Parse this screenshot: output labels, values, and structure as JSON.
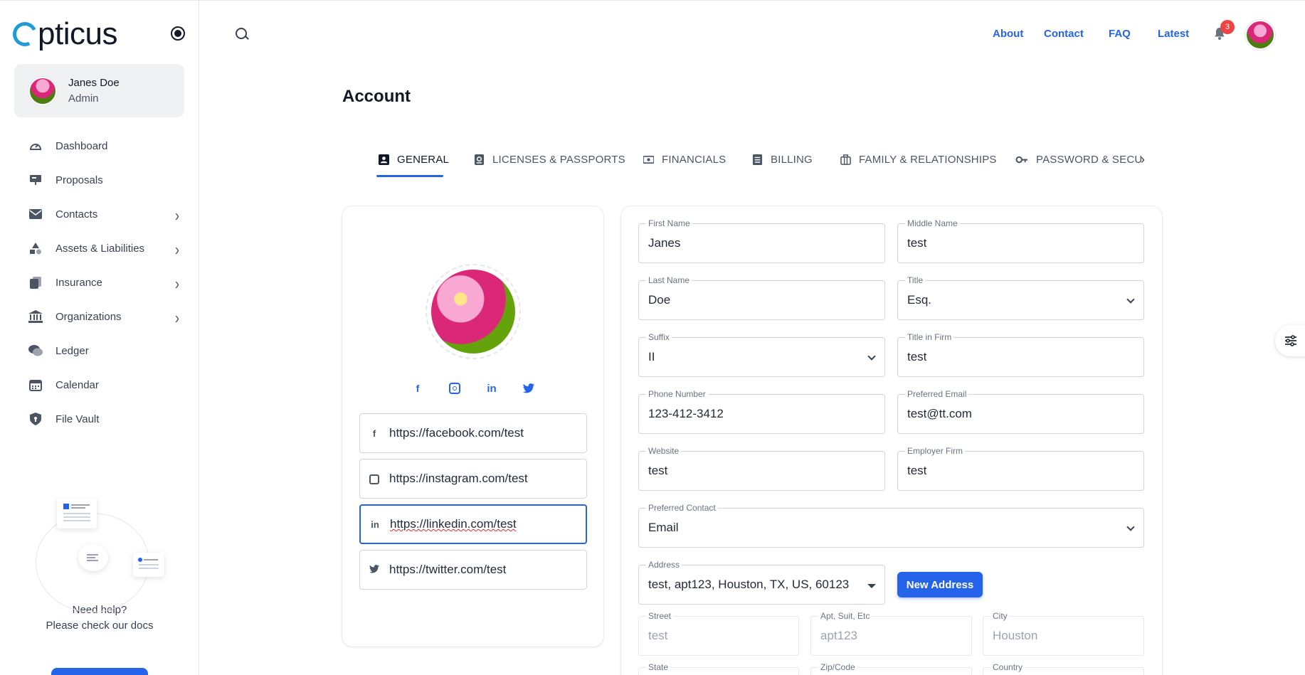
{
  "logo": {
    "text": "pticus"
  },
  "user": {
    "name": "Janes Doe",
    "role": "Admin"
  },
  "nav": [
    {
      "label": "Dashboard",
      "icon": "dashboard-icon",
      "has_children": false
    },
    {
      "label": "Proposals",
      "icon": "presentation-icon",
      "has_children": false
    },
    {
      "label": "Contacts",
      "icon": "mail-icon",
      "has_children": true
    },
    {
      "label": "Assets & Liabilities",
      "icon": "shapes-icon",
      "has_children": true
    },
    {
      "label": "Insurance",
      "icon": "documents-icon",
      "has_children": true
    },
    {
      "label": "Organizations",
      "icon": "bank-icon",
      "has_children": true
    },
    {
      "label": "Ledger",
      "icon": "chat-icon",
      "has_children": false
    },
    {
      "label": "Calendar",
      "icon": "calendar-icon",
      "has_children": false
    },
    {
      "label": "File Vault",
      "icon": "shield-lock-icon",
      "has_children": false
    }
  ],
  "help": {
    "line1": "Need help?",
    "line2": "Please check our docs"
  },
  "header": {
    "links": [
      "About",
      "Contact",
      "FAQ",
      "Latest"
    ],
    "notification_count": "3"
  },
  "page": {
    "title": "Account"
  },
  "tabs": [
    {
      "label": "GENERAL",
      "active": true
    },
    {
      "label": "LICENSES & PASSPORTS",
      "active": false
    },
    {
      "label": "FINANCIALS",
      "active": false
    },
    {
      "label": "BILLING",
      "active": false
    },
    {
      "label": "FAMILY & RELATIONSHIPS",
      "active": false
    },
    {
      "label": "PASSWORD & SECU",
      "active": false
    }
  ],
  "social": {
    "facebook": "https://facebook.com/test",
    "instagram": "https://instagram.com/test",
    "linkedin": "https://linkedin.com/test",
    "twitter": "https://twitter.com/test"
  },
  "form": {
    "first_name": {
      "label": "First Name",
      "value": "Janes"
    },
    "middle_name": {
      "label": "Middle Name",
      "value": "test"
    },
    "last_name": {
      "label": "Last Name",
      "value": "Doe"
    },
    "title": {
      "label": "Title",
      "value": "Esq."
    },
    "suffix": {
      "label": "Suffix",
      "value": "II"
    },
    "title_in_firm": {
      "label": "Title in Firm",
      "value": "test"
    },
    "phone": {
      "label": "Phone Number",
      "value": "123-412-3412"
    },
    "preferred_email": {
      "label": "Preferred Email",
      "value": "test@tt.com"
    },
    "website": {
      "label": "Website",
      "value": "test"
    },
    "employer_firm": {
      "label": "Employer Firm",
      "value": "test"
    },
    "preferred_contact": {
      "label": "Preferred Contact",
      "value": "Email"
    },
    "address": {
      "label": "Address",
      "value": "test, apt123, Houston, TX, US, 60123"
    },
    "new_address_label": "New Address",
    "street": {
      "label": "Street",
      "value": "test"
    },
    "apt": {
      "label": "Apt, Suit, Etc",
      "value": "apt123"
    },
    "city": {
      "label": "City",
      "value": "Houston"
    },
    "state": {
      "label": "State",
      "value": ""
    },
    "zip": {
      "label": "Zip/Code",
      "value": ""
    },
    "country": {
      "label": "Country",
      "value": ""
    }
  },
  "colors": {
    "accent": "#2563eb",
    "logo_o": "#1e9bd9",
    "badge": "#ef4444"
  }
}
